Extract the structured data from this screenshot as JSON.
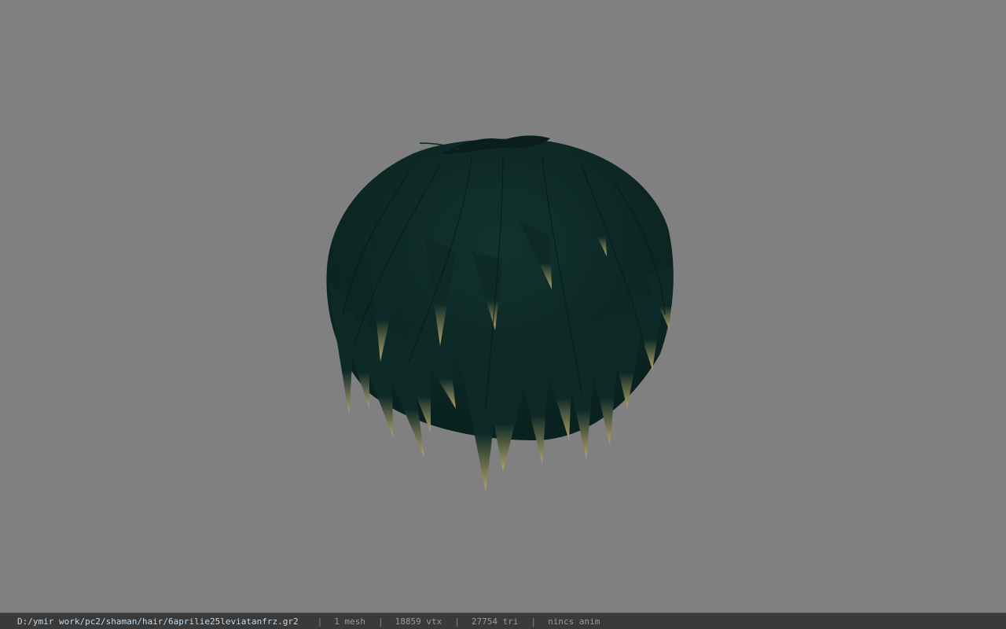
{
  "viewer": {
    "background_color": "#808080",
    "model": {
      "name": "hair-mesh",
      "hair_color": "#0e2a27",
      "tip_color": "#b6a56b"
    }
  },
  "status_bar": {
    "file_path": "D:/ymir work/pc2/shaman/hair/6aprilie25leviatanfrz.gr2",
    "separator": "|",
    "mesh_count": "1 mesh",
    "vertex_count": "18859 vtx",
    "triangle_count": "27754 tri",
    "anim_status": "nincs anim"
  }
}
